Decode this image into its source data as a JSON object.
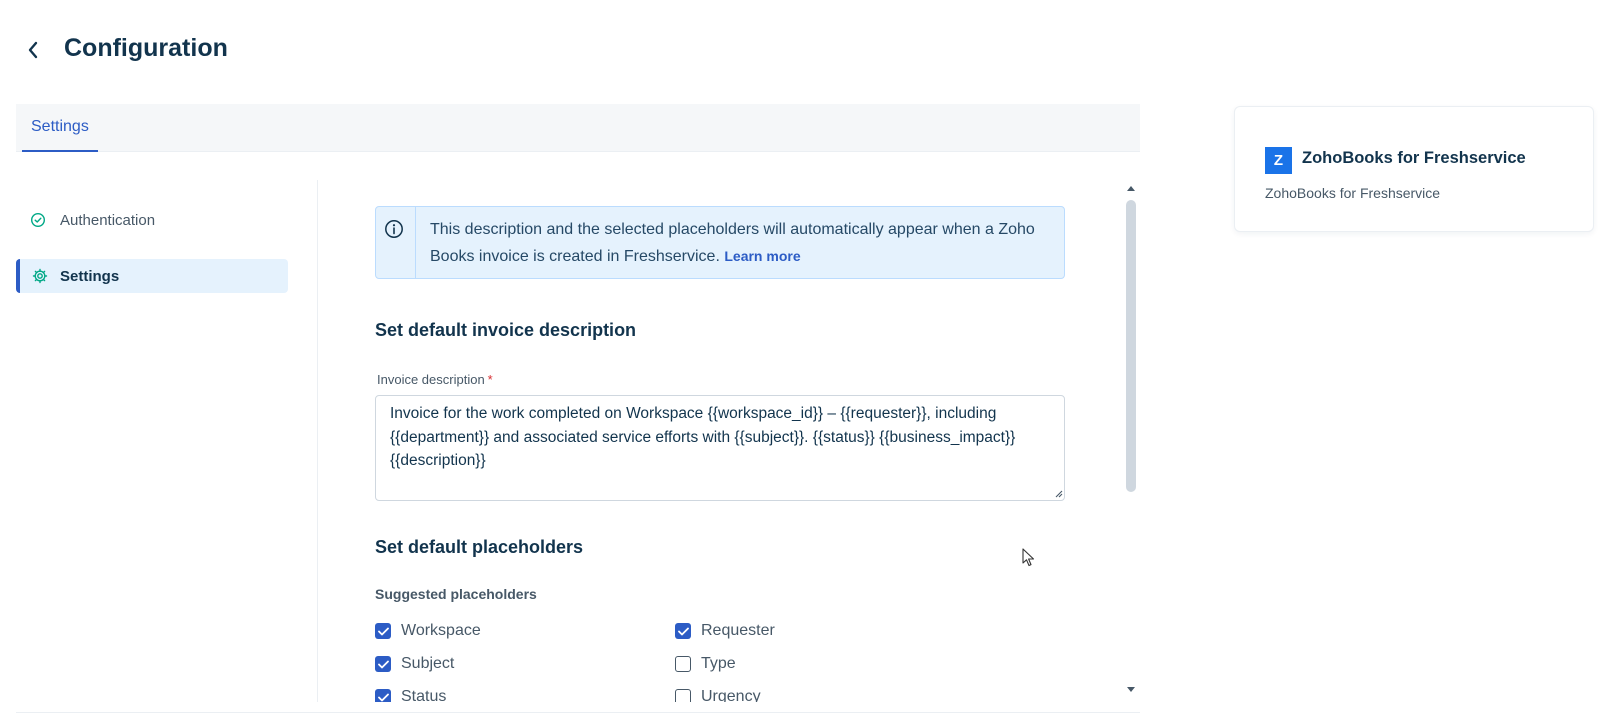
{
  "header": {
    "title": "Configuration",
    "back_icon": "chevron-left-icon"
  },
  "tabs": [
    {
      "label": "Settings",
      "active": true
    }
  ],
  "sidebar": {
    "items": [
      {
        "label": "Authentication",
        "icon": "check-circle-icon",
        "active": false
      },
      {
        "label": "Settings",
        "icon": "gear-icon",
        "active": true
      }
    ]
  },
  "info_banner": {
    "text": "This description and the selected placeholders will automatically appear when a Zoho Books invoice is created in Freshservice.",
    "link": "Learn more"
  },
  "invoice_section": {
    "title": "Set default invoice description",
    "field_label": "Invoice description",
    "required_mark": "*",
    "value": "Invoice for the work completed on Workspace {{workspace_id}} – {{requester}}, including {{department}} and associated service efforts with {{subject}}. {{status}} {{business_impact}} {{description}}"
  },
  "placeholders_section": {
    "title": "Set default placeholders",
    "subtitle": "Suggested placeholders",
    "left": [
      {
        "label": "Workspace",
        "checked": true
      },
      {
        "label": "Subject",
        "checked": true
      },
      {
        "label": "Status",
        "checked": true
      }
    ],
    "right": [
      {
        "label": "Requester",
        "checked": true
      },
      {
        "label": "Type",
        "checked": false
      },
      {
        "label": "Urgency",
        "checked": false
      }
    ]
  },
  "app_card": {
    "logo_letter": "Z",
    "name": "ZohoBooks for Freshservice",
    "subtitle": "ZohoBooks for Freshservice"
  },
  "colors": {
    "primary": "#2c5cc5",
    "text": "#12344d",
    "info_bg": "#e5f2fd",
    "logo": "#1a73e8",
    "success": "#00a886"
  }
}
